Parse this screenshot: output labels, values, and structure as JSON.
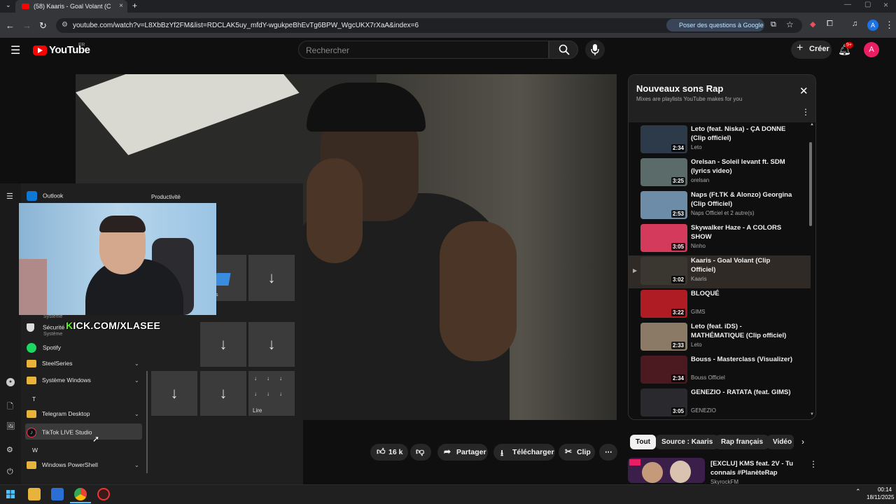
{
  "browser": {
    "tab_title": "(58) Kaaris - Goal Volant (C",
    "url": "youtube.com/watch?v=L8XbBzYf2FM&list=RDCLAK5uy_mfdY-wgukpeBhEvTg6BPW_WgcUKX7rXaA&index=6",
    "google_chip": "Poser des questions à Google",
    "profile_initial": "A"
  },
  "youtube": {
    "logo_text": "YouTube",
    "region": "FR",
    "search_placeholder": "Rechercher",
    "create_label": "Créer",
    "notif_count": "9+",
    "avatar_initial": "A"
  },
  "playlist": {
    "title": "Nouveaux sons Rap",
    "subtitle": "Mixes are playlists YouTube makes for you",
    "items": [
      {
        "title": "Leto (feat. Niska) - ÇA DONNE (Clip officiel)",
        "channel": "Leto",
        "duration": "2:34",
        "active": false,
        "thumb": "#2d3a4a"
      },
      {
        "title": "Orelsan - Soleil levant ft. SDM (lyrics video)",
        "channel": "orelsan",
        "duration": "3:25",
        "active": false,
        "thumb": "#5a6b6a"
      },
      {
        "title": "Naps (Ft.TK & Alonzo) Georgina (Clip Officiel)",
        "channel": "Naps Officiel et 2 autre(s)",
        "duration": "2:53",
        "active": false,
        "thumb": "#6d8ca8"
      },
      {
        "title": "Skywalker Haze - A COLORS SHOW",
        "channel": "Ninho",
        "duration": "3:05",
        "active": false,
        "thumb": "#d43a5c"
      },
      {
        "title": "Kaaris - Goal Volant (Clip Officiel)",
        "channel": "Kaaris",
        "duration": "3:02",
        "active": true,
        "thumb": "#3a3630"
      },
      {
        "title": "BLOQUÉ",
        "channel": "GIMS",
        "duration": "3:22",
        "active": false,
        "thumb": "#b01c24"
      },
      {
        "title": "Leto (feat. iDS) - MATHÉMATIQUE (Clip officiel)",
        "channel": "Leto",
        "duration": "2:33",
        "active": false,
        "thumb": "#8a7a66"
      },
      {
        "title": "Bouss - Masterclass (Visualizer)",
        "channel": "Bouss Officiel",
        "duration": "2:34",
        "active": false,
        "thumb": "#4a1a20"
      },
      {
        "title": "GENEZIO - RATATA (feat. GIMS)",
        "channel": "GENEZIO",
        "duration": "3:05",
        "active": false,
        "thumb": "#2a2a2e"
      }
    ]
  },
  "actions": {
    "likes": "16 k",
    "share": "Partager",
    "download": "Télécharger",
    "clip": "Clip"
  },
  "chips": [
    "Tout",
    "Source : Kaaris",
    "Rap français",
    "Vidéo"
  ],
  "recommended": {
    "title": "[EXCLU] KMS feat. 2V - Tu connais #PlanèteRap",
    "channel": "SkyrockFM"
  },
  "start_menu": {
    "outlook": "Outlook",
    "group_title": "Productivité",
    "systeme_label": "Système",
    "securite": "Sécurité",
    "securite_sub": "Système",
    "spotify": "Spotify",
    "steelseries": "SteelSeries",
    "systeme_windows": "Système Windows",
    "letter_t": "T",
    "telegram": "Telegram Desktop",
    "tiktok": "TikTok LIVE Studio",
    "letter_w": "W",
    "powershell": "Windows PowerShell",
    "lire": "Lire",
    "partial_tile": "s"
  },
  "overlay": {
    "kick_prefix": "K",
    "kick_rest": "ICK.COM/XLASEE"
  },
  "taskbar": {
    "time": "00:14",
    "date": "18/11/2025"
  }
}
